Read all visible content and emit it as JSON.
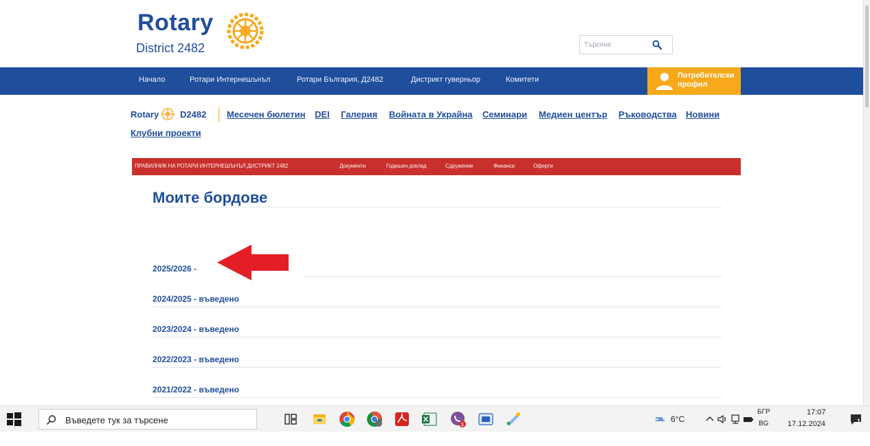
{
  "header": {
    "logo_word": "Rotary",
    "logo_district": "District 2482",
    "search_placeholder": "Търсене"
  },
  "main_nav": {
    "items": [
      "Начало",
      "Ротари Интернешънъл",
      "Ротари България, Д2482",
      "Дистрикт гуверньор",
      "Комитети"
    ],
    "profile_label": "Потребителски профил"
  },
  "sub_nav": {
    "logo_word": "Rotary",
    "district_code": "D2482",
    "links": [
      "Месечен бюлетин",
      "DEI",
      "Галерия",
      "Войната в Украйна",
      "Семинари",
      "Медиен център",
      "Ръководства",
      "Новини",
      "Клубни проекти"
    ]
  },
  "red_bar": {
    "items": [
      "ПРАВИЛНИК НА РОТАРИ ИНТЕРНЕШЪНЪЛ ДИСТРИКТ 2482",
      "Документи",
      "Годишен доклад",
      "Сдружение",
      "Финанси",
      "Оферти"
    ]
  },
  "content": {
    "title": "Моите бордове",
    "boards": [
      "2025/2026 -",
      "2024/2025 - въведено",
      "2023/2024 - въведено",
      "2022/2023 - въведено",
      "2021/2022 - въведено"
    ]
  },
  "taskbar": {
    "search_placeholder": "Въведете тук за търсене",
    "apps": [
      "task-view-icon",
      "file-explorer-icon",
      "chrome-icon",
      "chrome-alt-icon",
      "acrobat-icon",
      "excel-icon",
      "viber-icon",
      "app-icon",
      "paint-icon"
    ],
    "weather": "6°C",
    "lang_top": "БГР",
    "lang_bottom": "BG",
    "time": "17:07",
    "date": "17.12.2024",
    "notification_count": "1"
  },
  "colors": {
    "rotary_blue": "#1f4e9c",
    "rotary_gold": "#f7a81b",
    "red_bar": "#c9302c",
    "arrow": "#e41e26"
  }
}
